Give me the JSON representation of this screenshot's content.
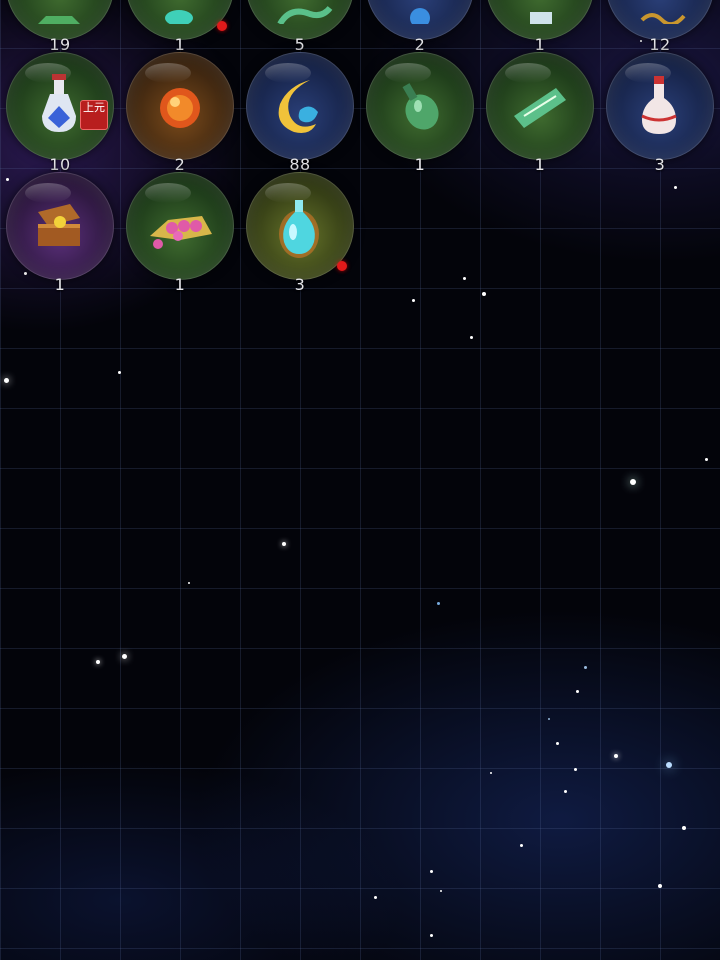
{
  "inventory": {
    "rows": [
      {
        "items": [
          {
            "icon": "green-gem-icon",
            "count": "19"
          },
          {
            "icon": "teal-crystal-icon",
            "count": "1",
            "new_indicator": true
          },
          {
            "icon": "green-feather-icon",
            "count": "5"
          },
          {
            "icon": "blue-flower-icon",
            "count": "2"
          },
          {
            "icon": "scroll-icon",
            "count": "1"
          },
          {
            "icon": "golden-tassel-icon",
            "count": "12"
          }
        ]
      },
      {
        "items": [
          {
            "icon": "blue-potion-bottle-icon",
            "count": "10",
            "badge": "上元"
          },
          {
            "icon": "fire-orb-icon",
            "count": "2"
          },
          {
            "icon": "golden-swirl-icon",
            "count": "88"
          },
          {
            "icon": "green-flask-icon",
            "count": "1"
          },
          {
            "icon": "green-talisman-icon",
            "count": "1"
          },
          {
            "icon": "white-vase-icon",
            "count": "3"
          }
        ]
      },
      {
        "items": [
          {
            "icon": "treasure-chest-icon",
            "count": "1"
          },
          {
            "icon": "pink-pearls-icon",
            "count": "1"
          },
          {
            "icon": "cyan-elixir-bottle-icon",
            "count": "3",
            "new_indicator": true
          }
        ]
      }
    ]
  },
  "colors": {
    "background": "#03040a",
    "count_text": "#e6e6ea",
    "new_indicator": "#e21a1a",
    "badge": "#b81e1e"
  }
}
